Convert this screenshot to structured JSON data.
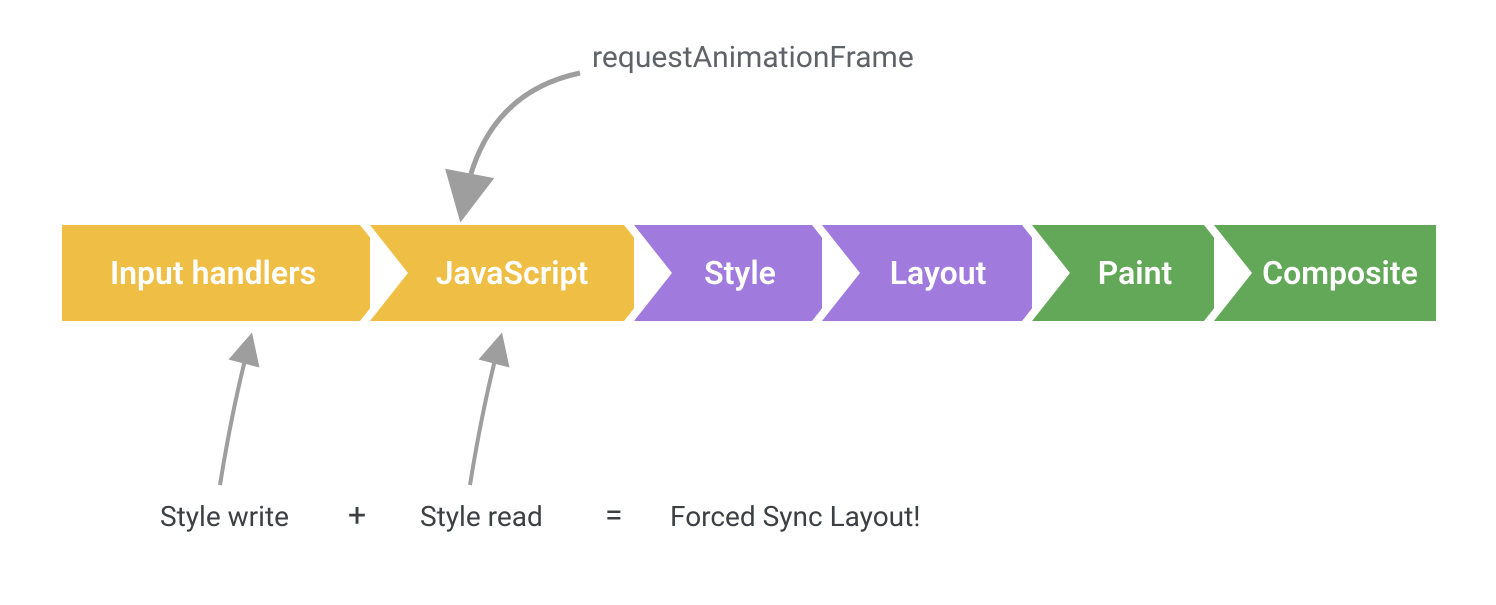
{
  "topAnnotation": "requestAnimationFrame",
  "stages": [
    {
      "id": "input-handlers",
      "label": "Input handlers",
      "color": "yellow"
    },
    {
      "id": "javascript",
      "label": "JavaScript",
      "color": "yellow"
    },
    {
      "id": "style",
      "label": "Style",
      "color": "purple"
    },
    {
      "id": "layout",
      "label": "Layout",
      "color": "purple"
    },
    {
      "id": "paint",
      "label": "Paint",
      "color": "green"
    },
    {
      "id": "composite",
      "label": "Composite",
      "color": "green"
    }
  ],
  "bottom": {
    "left": "Style write",
    "plus": "+",
    "middle": "Style read",
    "equals": "=",
    "right": "Forced Sync Layout!"
  },
  "colors": {
    "yellow": "#eebe45",
    "purple": "#a17add",
    "green": "#63a758",
    "connector": "#9e9e9e"
  }
}
